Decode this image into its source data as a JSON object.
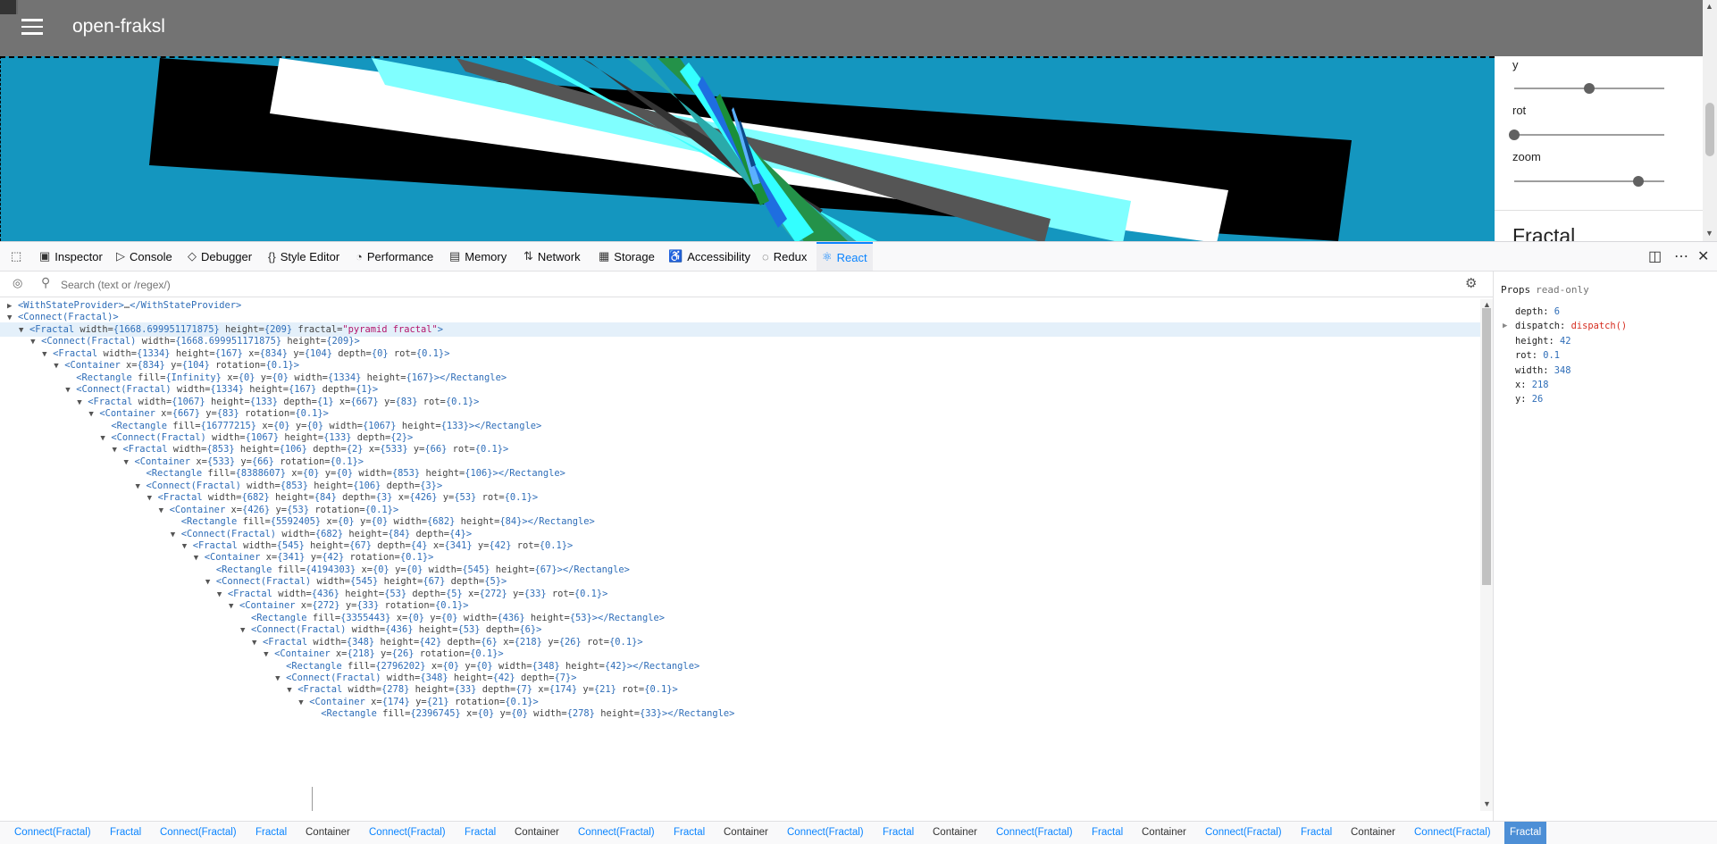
{
  "app": {
    "title": "open-fraksl",
    "controls": [
      {
        "label": "y",
        "value_fraction": 0.5
      },
      {
        "label": "rot",
        "value_fraction": 0.0
      },
      {
        "label": "zoom",
        "value_fraction": 0.83
      }
    ],
    "section_heading": "Fractal"
  },
  "devtools": {
    "tabs": [
      {
        "label": "Inspector",
        "icon": "inspector-icon"
      },
      {
        "label": "Console",
        "icon": "console-icon"
      },
      {
        "label": "Debugger",
        "icon": "debugger-icon"
      },
      {
        "label": "Style Editor",
        "icon": "style-editor-icon"
      },
      {
        "label": "Performance",
        "icon": "performance-icon"
      },
      {
        "label": "Memory",
        "icon": "memory-icon"
      },
      {
        "label": "Network",
        "icon": "network-icon"
      },
      {
        "label": "Storage",
        "icon": "storage-icon"
      },
      {
        "label": "Accessibility",
        "icon": "accessibility-icon"
      },
      {
        "label": "Redux",
        "icon": "redux-icon"
      },
      {
        "label": "React",
        "icon": "react-icon",
        "active": true
      }
    ],
    "search_placeholder": "Search (text or /regex/)",
    "tree": [
      {
        "depth": 0,
        "expanded": false,
        "html": "<span class='tag'>&lt;WithStateProvider&gt;</span><span class='an'>…</span><span class='tag'>&lt;/WithStateProvider&gt;</span>"
      },
      {
        "depth": 0,
        "expanded": true,
        "html": "<span class='tag'>&lt;Connect(Fractal)&gt;</span>"
      },
      {
        "depth": 1,
        "expanded": true,
        "selected": true,
        "html": "<span class='tag'>&lt;Fractal</span> <span class='an'>width=</span><span class='av'>{1668.699951171875}</span> <span class='an'>height=</span><span class='av'>{209}</span> <span class='an'>fractal=</span><span class='str'>\"pyramid fractal\"</span><span class='tag'>&gt;</span>"
      },
      {
        "depth": 2,
        "expanded": true,
        "html": "<span class='tag'>&lt;Connect(Fractal)</span> <span class='an'>width=</span><span class='av'>{1668.699951171875}</span> <span class='an'>height=</span><span class='av'>{209}</span><span class='tag'>&gt;</span>"
      },
      {
        "depth": 3,
        "expanded": true,
        "html": "<span class='tag'>&lt;Fractal</span> <span class='an'>width=</span><span class='av'>{1334}</span> <span class='an'>height=</span><span class='av'>{167}</span> <span class='an'>x=</span><span class='av'>{834}</span> <span class='an'>y=</span><span class='av'>{104}</span> <span class='an'>depth=</span><span class='av'>{0}</span> <span class='an'>rot=</span><span class='av'>{0.1}</span><span class='tag'>&gt;</span>"
      },
      {
        "depth": 4,
        "expanded": true,
        "html": "<span class='tag'>&lt;Container</span> <span class='an'>x=</span><span class='av'>{834}</span> <span class='an'>y=</span><span class='av'>{104}</span> <span class='an'>rotation=</span><span class='av'>{0.1}</span><span class='tag'>&gt;</span>"
      },
      {
        "depth": 5,
        "leaf": true,
        "html": "<span class='tag'>&lt;Rectangle</span> <span class='an'>fill=</span><span class='av'>{Infinity}</span> <span class='an'>x=</span><span class='av'>{0}</span> <span class='an'>y=</span><span class='av'>{0}</span> <span class='an'>width=</span><span class='av'>{1334}</span> <span class='an'>height=</span><span class='av'>{167}</span><span class='tag'>&gt;&lt;/Rectangle&gt;</span>"
      },
      {
        "depth": 5,
        "expanded": true,
        "html": "<span class='tag'>&lt;Connect(Fractal)</span> <span class='an'>width=</span><span class='av'>{1334}</span> <span class='an'>height=</span><span class='av'>{167}</span> <span class='an'>depth=</span><span class='av'>{1}</span><span class='tag'>&gt;</span>"
      },
      {
        "depth": 6,
        "expanded": true,
        "html": "<span class='tag'>&lt;Fractal</span> <span class='an'>width=</span><span class='av'>{1067}</span> <span class='an'>height=</span><span class='av'>{133}</span> <span class='an'>depth=</span><span class='av'>{1}</span> <span class='an'>x=</span><span class='av'>{667}</span> <span class='an'>y=</span><span class='av'>{83}</span> <span class='an'>rot=</span><span class='av'>{0.1}</span><span class='tag'>&gt;</span>"
      },
      {
        "depth": 7,
        "expanded": true,
        "html": "<span class='tag'>&lt;Container</span> <span class='an'>x=</span><span class='av'>{667}</span> <span class='an'>y=</span><span class='av'>{83}</span> <span class='an'>rotation=</span><span class='av'>{0.1}</span><span class='tag'>&gt;</span>"
      },
      {
        "depth": 8,
        "leaf": true,
        "html": "<span class='tag'>&lt;Rectangle</span> <span class='an'>fill=</span><span class='av'>{16777215}</span> <span class='an'>x=</span><span class='av'>{0}</span> <span class='an'>y=</span><span class='av'>{0}</span> <span class='an'>width=</span><span class='av'>{1067}</span> <span class='an'>height=</span><span class='av'>{133}</span><span class='tag'>&gt;&lt;/Rectangle&gt;</span>"
      },
      {
        "depth": 8,
        "expanded": true,
        "html": "<span class='tag'>&lt;Connect(Fractal)</span> <span class='an'>width=</span><span class='av'>{1067}</span> <span class='an'>height=</span><span class='av'>{133}</span> <span class='an'>depth=</span><span class='av'>{2}</span><span class='tag'>&gt;</span>"
      },
      {
        "depth": 9,
        "expanded": true,
        "html": "<span class='tag'>&lt;Fractal</span> <span class='an'>width=</span><span class='av'>{853}</span> <span class='an'>height=</span><span class='av'>{106}</span> <span class='an'>depth=</span><span class='av'>{2}</span> <span class='an'>x=</span><span class='av'>{533}</span> <span class='an'>y=</span><span class='av'>{66}</span> <span class='an'>rot=</span><span class='av'>{0.1}</span><span class='tag'>&gt;</span>"
      },
      {
        "depth": 10,
        "expanded": true,
        "html": "<span class='tag'>&lt;Container</span> <span class='an'>x=</span><span class='av'>{533}</span> <span class='an'>y=</span><span class='av'>{66}</span> <span class='an'>rotation=</span><span class='av'>{0.1}</span><span class='tag'>&gt;</span>"
      },
      {
        "depth": 11,
        "leaf": true,
        "html": "<span class='tag'>&lt;Rectangle</span> <span class='an'>fill=</span><span class='av'>{8388607}</span> <span class='an'>x=</span><span class='av'>{0}</span> <span class='an'>y=</span><span class='av'>{0}</span> <span class='an'>width=</span><span class='av'>{853}</span> <span class='an'>height=</span><span class='av'>{106}</span><span class='tag'>&gt;&lt;/Rectangle&gt;</span>"
      },
      {
        "depth": 11,
        "expanded": true,
        "html": "<span class='tag'>&lt;Connect(Fractal)</span> <span class='an'>width=</span><span class='av'>{853}</span> <span class='an'>height=</span><span class='av'>{106}</span> <span class='an'>depth=</span><span class='av'>{3}</span><span class='tag'>&gt;</span>"
      },
      {
        "depth": 12,
        "expanded": true,
        "html": "<span class='tag'>&lt;Fractal</span> <span class='an'>width=</span><span class='av'>{682}</span> <span class='an'>height=</span><span class='av'>{84}</span> <span class='an'>depth=</span><span class='av'>{3}</span> <span class='an'>x=</span><span class='av'>{426}</span> <span class='an'>y=</span><span class='av'>{53}</span> <span class='an'>rot=</span><span class='av'>{0.1}</span><span class='tag'>&gt;</span>"
      },
      {
        "depth": 13,
        "expanded": true,
        "html": "<span class='tag'>&lt;Container</span> <span class='an'>x=</span><span class='av'>{426}</span> <span class='an'>y=</span><span class='av'>{53}</span> <span class='an'>rotation=</span><span class='av'>{0.1}</span><span class='tag'>&gt;</span>"
      },
      {
        "depth": 14,
        "leaf": true,
        "html": "<span class='tag'>&lt;Rectangle</span> <span class='an'>fill=</span><span class='av'>{5592405}</span> <span class='an'>x=</span><span class='av'>{0}</span> <span class='an'>y=</span><span class='av'>{0}</span> <span class='an'>width=</span><span class='av'>{682}</span> <span class='an'>height=</span><span class='av'>{84}</span><span class='tag'>&gt;&lt;/Rectangle&gt;</span>"
      },
      {
        "depth": 14,
        "expanded": true,
        "html": "<span class='tag'>&lt;Connect(Fractal)</span> <span class='an'>width=</span><span class='av'>{682}</span> <span class='an'>height=</span><span class='av'>{84}</span> <span class='an'>depth=</span><span class='av'>{4}</span><span class='tag'>&gt;</span>"
      },
      {
        "depth": 15,
        "expanded": true,
        "html": "<span class='tag'>&lt;Fractal</span> <span class='an'>width=</span><span class='av'>{545}</span> <span class='an'>height=</span><span class='av'>{67}</span> <span class='an'>depth=</span><span class='av'>{4}</span> <span class='an'>x=</span><span class='av'>{341}</span> <span class='an'>y=</span><span class='av'>{42}</span> <span class='an'>rot=</span><span class='av'>{0.1}</span><span class='tag'>&gt;</span>"
      },
      {
        "depth": 16,
        "expanded": true,
        "html": "<span class='tag'>&lt;Container</span> <span class='an'>x=</span><span class='av'>{341}</span> <span class='an'>y=</span><span class='av'>{42}</span> <span class='an'>rotation=</span><span class='av'>{0.1}</span><span class='tag'>&gt;</span>"
      },
      {
        "depth": 17,
        "leaf": true,
        "html": "<span class='tag'>&lt;Rectangle</span> <span class='an'>fill=</span><span class='av'>{4194303}</span> <span class='an'>x=</span><span class='av'>{0}</span> <span class='an'>y=</span><span class='av'>{0}</span> <span class='an'>width=</span><span class='av'>{545}</span> <span class='an'>height=</span><span class='av'>{67}</span><span class='tag'>&gt;&lt;/Rectangle&gt;</span>"
      },
      {
        "depth": 17,
        "expanded": true,
        "html": "<span class='tag'>&lt;Connect(Fractal)</span> <span class='an'>width=</span><span class='av'>{545}</span> <span class='an'>height=</span><span class='av'>{67}</span> <span class='an'>depth=</span><span class='av'>{5}</span><span class='tag'>&gt;</span>"
      },
      {
        "depth": 18,
        "expanded": true,
        "html": "<span class='tag'>&lt;Fractal</span> <span class='an'>width=</span><span class='av'>{436}</span> <span class='an'>height=</span><span class='av'>{53}</span> <span class='an'>depth=</span><span class='av'>{5}</span> <span class='an'>x=</span><span class='av'>{272}</span> <span class='an'>y=</span><span class='av'>{33}</span> <span class='an'>rot=</span><span class='av'>{0.1}</span><span class='tag'>&gt;</span>"
      },
      {
        "depth": 19,
        "expanded": true,
        "html": "<span class='tag'>&lt;Container</span> <span class='an'>x=</span><span class='av'>{272}</span> <span class='an'>y=</span><span class='av'>{33}</span> <span class='an'>rotation=</span><span class='av'>{0.1}</span><span class='tag'>&gt;</span>"
      },
      {
        "depth": 20,
        "leaf": true,
        "html": "<span class='tag'>&lt;Rectangle</span> <span class='an'>fill=</span><span class='av'>{3355443}</span> <span class='an'>x=</span><span class='av'>{0}</span> <span class='an'>y=</span><span class='av'>{0}</span> <span class='an'>width=</span><span class='av'>{436}</span> <span class='an'>height=</span><span class='av'>{53}</span><span class='tag'>&gt;&lt;/Rectangle&gt;</span>"
      },
      {
        "depth": 20,
        "expanded": true,
        "html": "<span class='tag'>&lt;Connect(Fractal)</span> <span class='an'>width=</span><span class='av'>{436}</span> <span class='an'>height=</span><span class='av'>{53}</span> <span class='an'>depth=</span><span class='av'>{6}</span><span class='tag'>&gt;</span>"
      },
      {
        "depth": 21,
        "expanded": true,
        "html": "<span class='tag'>&lt;Fractal</span> <span class='an'>width=</span><span class='av'>{348}</span> <span class='an'>height=</span><span class='av'>{42}</span> <span class='an'>depth=</span><span class='av'>{6}</span> <span class='an'>x=</span><span class='av'>{218}</span> <span class='an'>y=</span><span class='av'>{26}</span> <span class='an'>rot=</span><span class='av'>{0.1}</span><span class='tag'>&gt;</span>"
      },
      {
        "depth": 22,
        "expanded": true,
        "html": "<span class='tag'>&lt;Container</span> <span class='an'>x=</span><span class='av'>{218}</span> <span class='an'>y=</span><span class='av'>{26}</span> <span class='an'>rotation=</span><span class='av'>{0.1}</span><span class='tag'>&gt;</span>"
      },
      {
        "depth": 23,
        "leaf": true,
        "html": "<span class='tag'>&lt;Rectangle</span> <span class='an'>fill=</span><span class='av'>{2796202}</span> <span class='an'>x=</span><span class='av'>{0}</span> <span class='an'>y=</span><span class='av'>{0}</span> <span class='an'>width=</span><span class='av'>{348}</span> <span class='an'>height=</span><span class='av'>{42}</span><span class='tag'>&gt;&lt;/Rectangle&gt;</span>"
      },
      {
        "depth": 23,
        "expanded": true,
        "html": "<span class='tag'>&lt;Connect(Fractal)</span> <span class='an'>width=</span><span class='av'>{348}</span> <span class='an'>height=</span><span class='av'>{42}</span> <span class='an'>depth=</span><span class='av'>{7}</span><span class='tag'>&gt;</span>"
      },
      {
        "depth": 24,
        "expanded": true,
        "html": "<span class='tag'>&lt;Fractal</span> <span class='an'>width=</span><span class='av'>{278}</span> <span class='an'>height=</span><span class='av'>{33}</span> <span class='an'>depth=</span><span class='av'>{7}</span> <span class='an'>x=</span><span class='av'>{174}</span> <span class='an'>y=</span><span class='av'>{21}</span> <span class='an'>rot=</span><span class='av'>{0.1}</span><span class='tag'>&gt;</span>"
      },
      {
        "depth": 25,
        "expanded": true,
        "html": "<span class='tag'>&lt;Container</span> <span class='an'>x=</span><span class='av'>{174}</span> <span class='an'>y=</span><span class='av'>{21}</span> <span class='an'>rotation=</span><span class='av'>{0.1}</span><span class='tag'>&gt;</span>"
      },
      {
        "depth": 26,
        "leaf": true,
        "html": "<span class='tag'>&lt;Rectangle</span> <span class='an'>fill=</span><span class='av'>{2396745}</span> <span class='an'>x=</span><span class='av'>{0}</span> <span class='an'>y=</span><span class='av'>{0}</span> <span class='an'>width=</span><span class='av'>{278}</span> <span class='an'>height=</span><span class='av'>{33}</span><span class='tag'>&gt;&lt;/Rectangle&gt;</span>"
      }
    ],
    "props": {
      "title": "Props",
      "subtitle": "read-only",
      "items": [
        {
          "key": "depth",
          "value": "6"
        },
        {
          "key": "dispatch",
          "value": "dispatch()",
          "fn": true,
          "expandable": true
        },
        {
          "key": "height",
          "value": "42"
        },
        {
          "key": "rot",
          "value": "0.1"
        },
        {
          "key": "width",
          "value": "348"
        },
        {
          "key": "x",
          "value": "218"
        },
        {
          "key": "y",
          "value": "26"
        }
      ]
    },
    "breadcrumbs": [
      {
        "label": "Connect(Fractal)",
        "kind": "link"
      },
      {
        "label": "Fractal",
        "kind": "link"
      },
      {
        "label": "Connect(Fractal)",
        "kind": "link"
      },
      {
        "label": "Fractal",
        "kind": "link"
      },
      {
        "label": "Container",
        "kind": "plain"
      },
      {
        "label": "Connect(Fractal)",
        "kind": "link"
      },
      {
        "label": "Fractal",
        "kind": "link"
      },
      {
        "label": "Container",
        "kind": "plain"
      },
      {
        "label": "Connect(Fractal)",
        "kind": "link"
      },
      {
        "label": "Fractal",
        "kind": "link"
      },
      {
        "label": "Container",
        "kind": "plain"
      },
      {
        "label": "Connect(Fractal)",
        "kind": "link"
      },
      {
        "label": "Fractal",
        "kind": "link"
      },
      {
        "label": "Container",
        "kind": "plain"
      },
      {
        "label": "Connect(Fractal)",
        "kind": "link"
      },
      {
        "label": "Fractal",
        "kind": "link"
      },
      {
        "label": "Container",
        "kind": "plain"
      },
      {
        "label": "Connect(Fractal)",
        "kind": "link"
      },
      {
        "label": "Fractal",
        "kind": "link"
      },
      {
        "label": "Container",
        "kind": "plain"
      },
      {
        "label": "Connect(Fractal)",
        "kind": "link"
      },
      {
        "label": "Fractal",
        "kind": "active"
      }
    ]
  },
  "colors": {
    "appbar": "#737373",
    "canvas_bg": "#1496bf",
    "accent": "#0a84ff"
  }
}
